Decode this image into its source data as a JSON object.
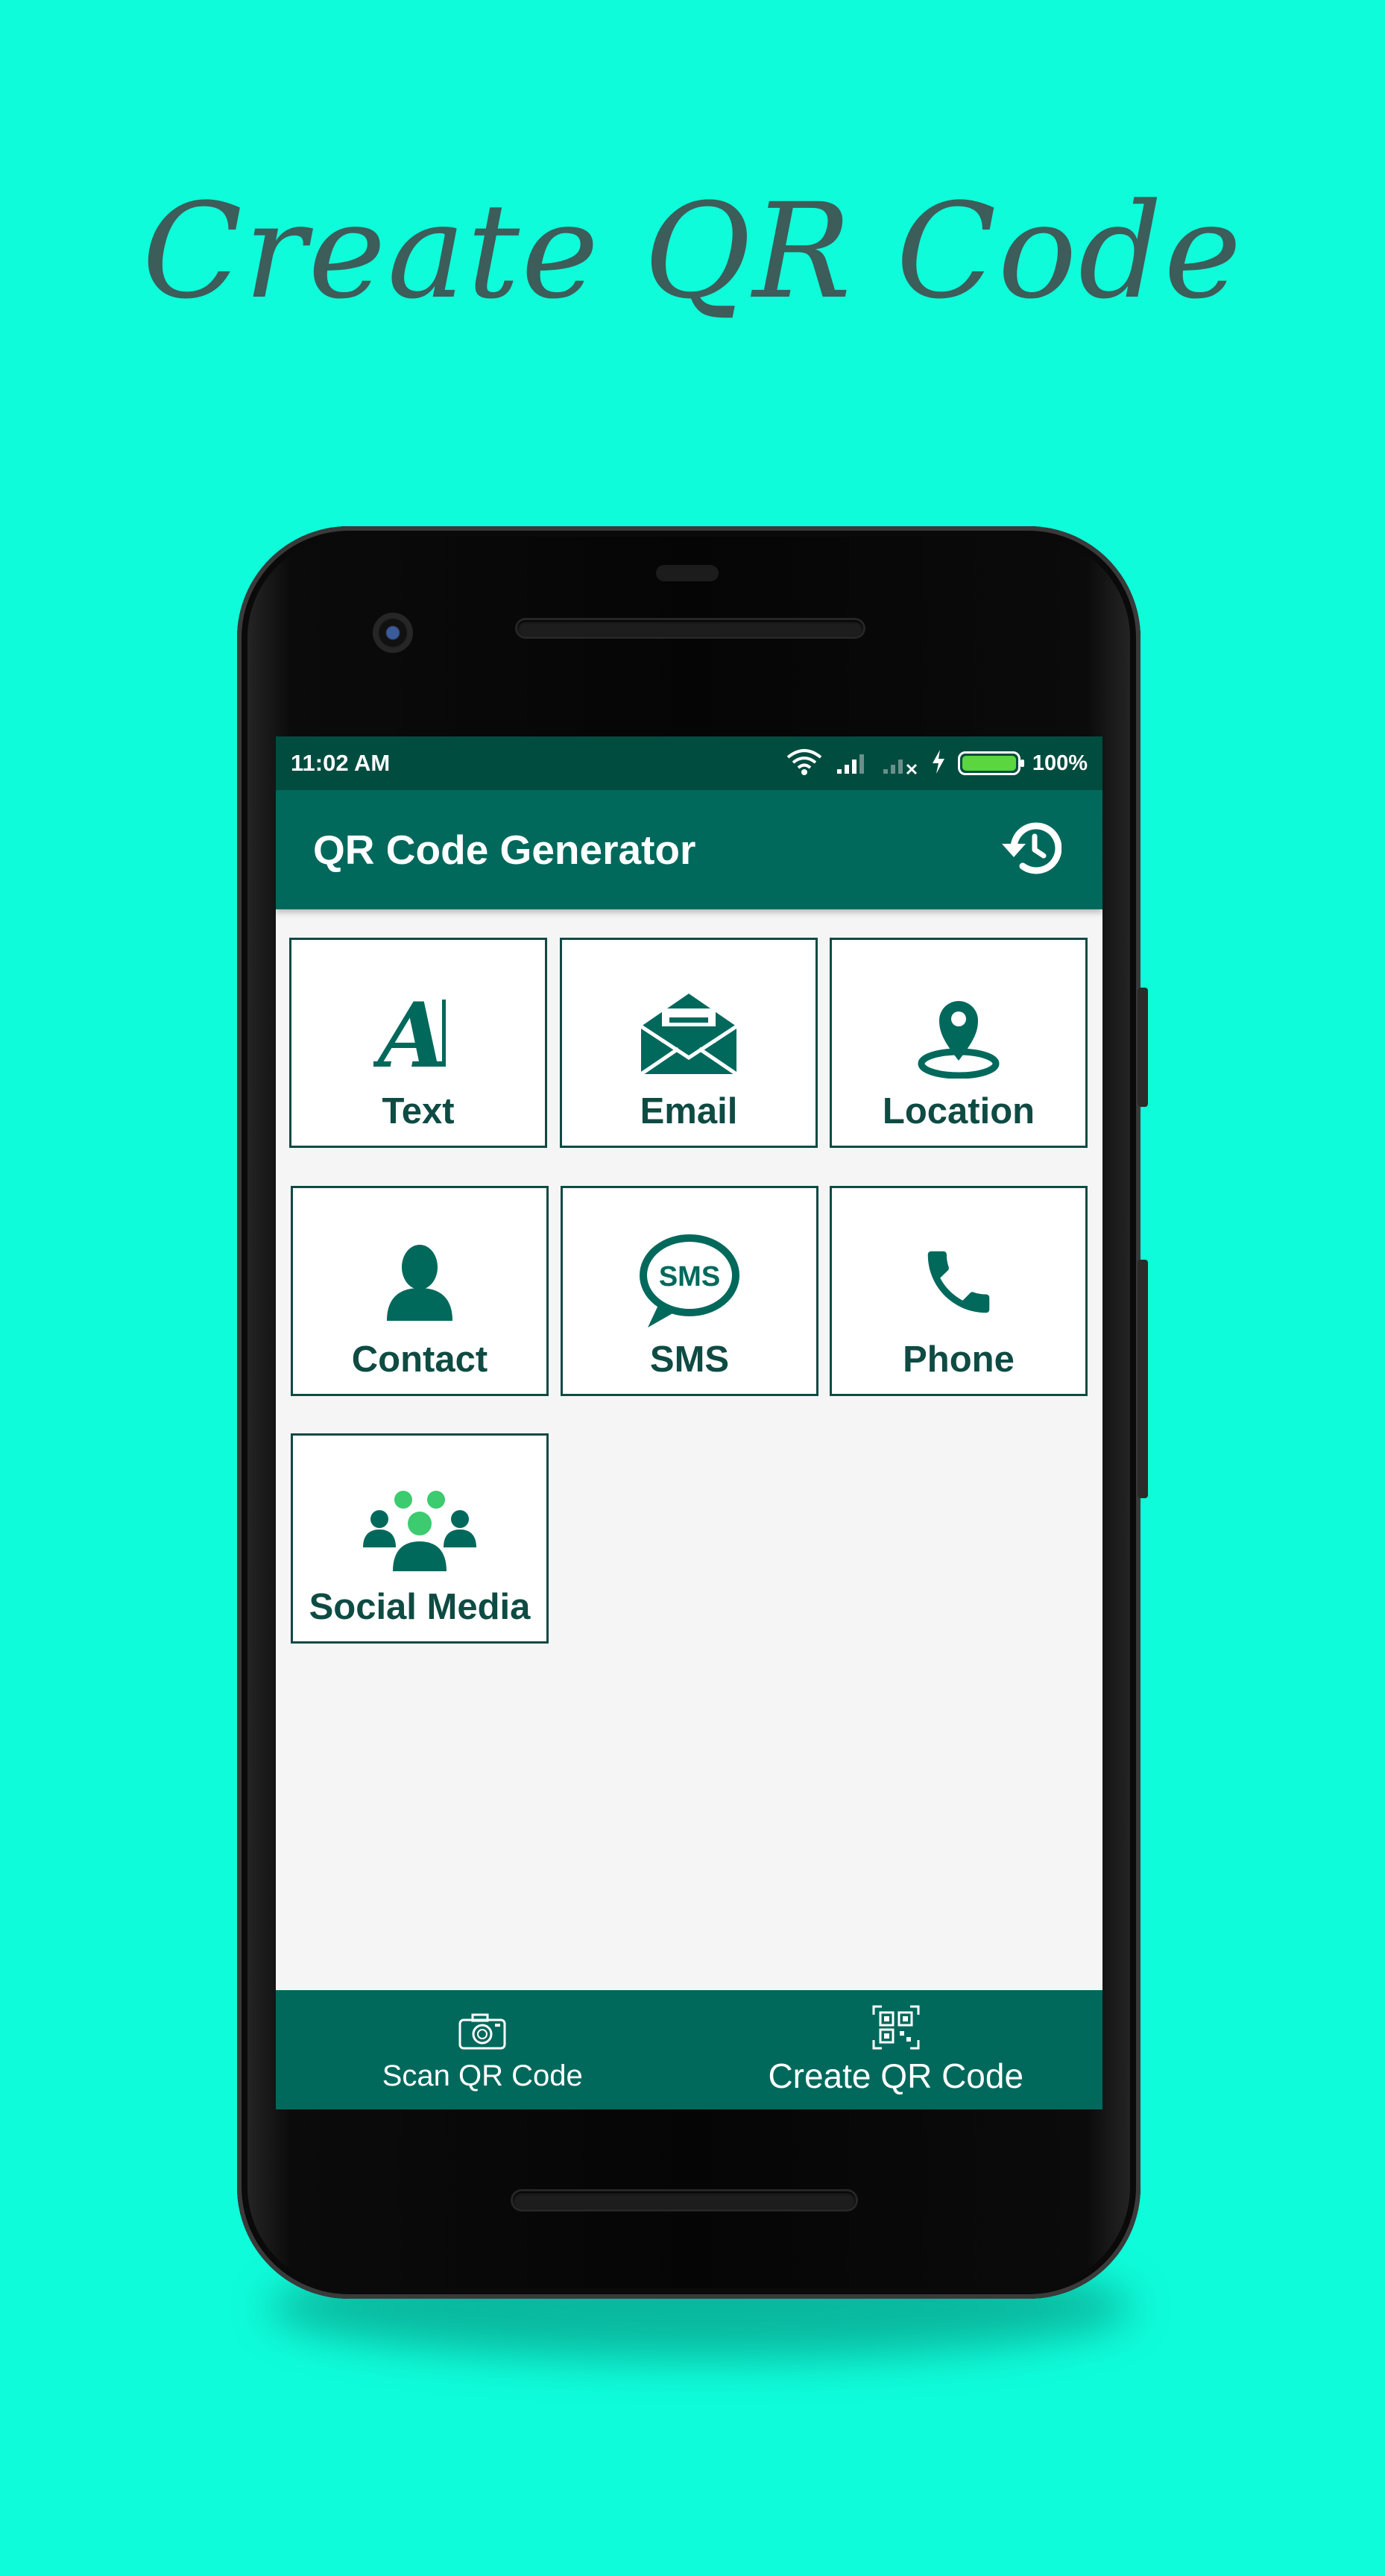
{
  "promo": {
    "title": "Create QR Code"
  },
  "status_bar": {
    "time": "11:02 AM",
    "battery_percent": "100%",
    "battery_level": 1.0
  },
  "app_bar": {
    "title": "QR Code Generator",
    "history_icon": "history-icon"
  },
  "tiles": [
    {
      "label": "Text",
      "icon": "text-icon"
    },
    {
      "label": "Email",
      "icon": "email-icon"
    },
    {
      "label": "Location",
      "icon": "location-icon"
    },
    {
      "label": "Contact",
      "icon": "contact-icon"
    },
    {
      "label": "SMS",
      "icon": "sms-icon"
    },
    {
      "label": "Phone",
      "icon": "phone-icon"
    },
    {
      "label": "Social Media",
      "icon": "social-media-icon"
    }
  ],
  "sms_icon_text": "SMS",
  "bottom_nav": [
    {
      "label": "Scan QR Code",
      "icon": "camera-icon"
    },
    {
      "label": "Create QR Code",
      "icon": "qr-code-icon"
    }
  ],
  "colors": {
    "background": "#0FFCDA",
    "primary": "#00695C",
    "primary_dark": "#004D40",
    "tile_border": "#0E4B43",
    "accent_green": "#3CCB6E"
  }
}
